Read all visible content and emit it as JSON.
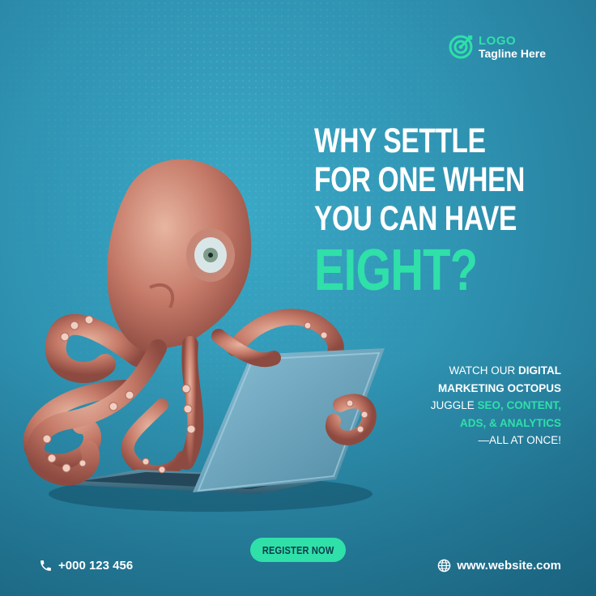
{
  "logo": {
    "name": "LOGO",
    "tagline": "Tagline Here"
  },
  "headline": {
    "lines": [
      "WHY SETTLE",
      "FOR ONE WHEN",
      "YOU CAN HAVE"
    ],
    "accent": "EIGHT?"
  },
  "copy": {
    "parts": [
      "WATCH OUR ",
      "DIGITAL",
      "MARKETING OCTOPUS",
      "JUGGLE ",
      "SEO, CONTENT,",
      "ADS, & ANALYTICS",
      "—ALL AT ONCE!"
    ]
  },
  "cta": {
    "label": "REGISTER NOW"
  },
  "footer": {
    "phone": "+000 123 456",
    "website": "www.website.com"
  },
  "colors": {
    "accent": "#2fe0a9",
    "background": "#2f93b2",
    "text": "#ffffff"
  },
  "icons": {
    "phone": "phone-icon",
    "website": "globe-icon",
    "logo": "target-logo-icon"
  }
}
